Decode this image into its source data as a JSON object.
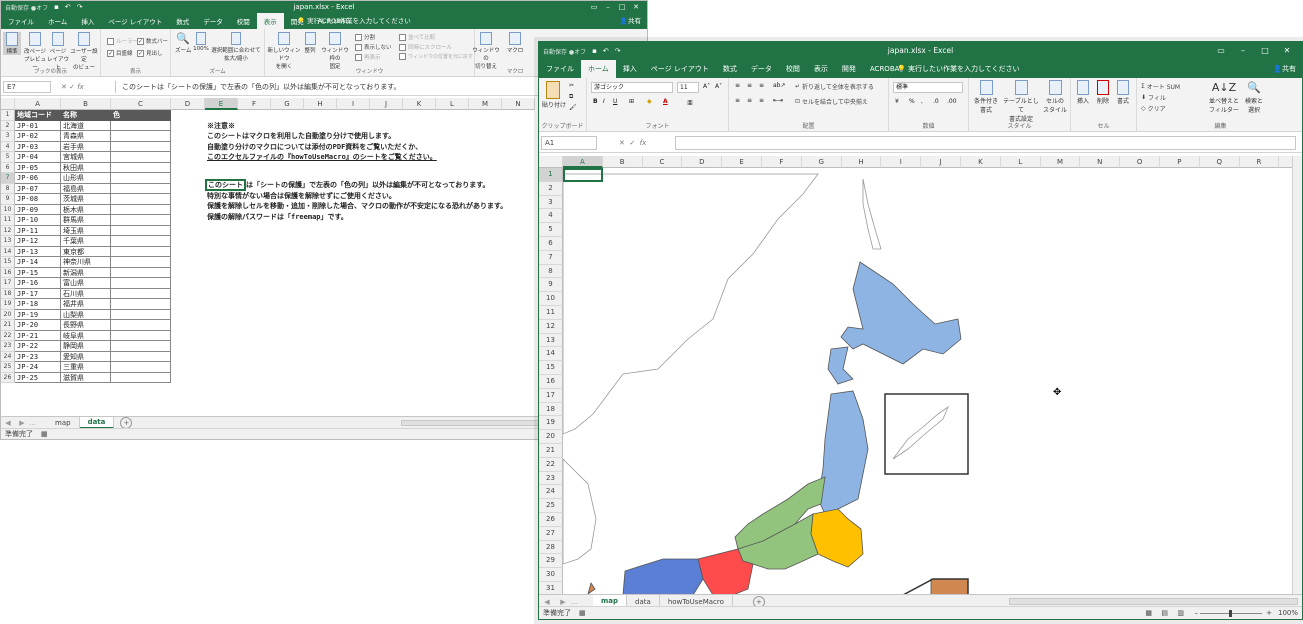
{
  "w1": {
    "title": "japan.xlsx - Excel",
    "autosave": "自動保存 ●オフ",
    "user": "共有",
    "search": "実行したい作業を入力してください",
    "tabs": [
      "ファイル",
      "ホーム",
      "挿入",
      "ページ レイアウト",
      "数式",
      "データ",
      "校閲",
      "表示",
      "開発",
      "ACROBAT"
    ],
    "active_tab": 7,
    "ribbon": {
      "g1_label": "ブックの表示",
      "b_normal": "標準",
      "b_pagebreak": "改ページ\nプレビュー",
      "b_pagelayout": "ページ\nレイアウト",
      "b_custom": "ユーザー設定\nのビュー",
      "g2_label": "表示",
      "cb_ruler": "ルーラー",
      "cb_formula": "数式バー",
      "cb_grid": "目盛線",
      "cb_headings": "見出し",
      "g3_label": "ズーム",
      "b_zoom": "ズーム",
      "b_100": "100%",
      "b_zoomsel": "選択範囲に合わせて\n拡大/縮小",
      "g4_label": "ウィンドウ",
      "b_newwin": "新しいウィンドウ\nを開く",
      "b_arrange": "整列",
      "b_freeze": "ウィンドウ枠の\n固定",
      "s_split": "分割",
      "s_hide": "表示しない",
      "s_unhide": "再表示",
      "s_side": "並べて比較",
      "s_sync": "同時にスクロール",
      "s_reset": "ウィンドウの位置を元に戻す",
      "b_switch": "ウィンドウの\n切り替え",
      "g5_label": "マクロ",
      "b_macro": "マクロ"
    },
    "namebox": "E7",
    "formula": "このシートは「シートの保護」で左表の「色の列」以外は編集が不可となっております。",
    "columns": [
      "A",
      "B",
      "C",
      "D",
      "E",
      "F",
      "G",
      "H",
      "I",
      "J",
      "K",
      "L",
      "M",
      "N"
    ],
    "header_row": [
      "地域コード",
      "名称",
      "色"
    ],
    "rows": [
      [
        "JP-01",
        "北海道"
      ],
      [
        "JP-02",
        "青森県"
      ],
      [
        "JP-03",
        "岩手県"
      ],
      [
        "JP-04",
        "宮城県"
      ],
      [
        "JP-05",
        "秋田県"
      ],
      [
        "JP-06",
        "山形県"
      ],
      [
        "JP-07",
        "福島県"
      ],
      [
        "JP-08",
        "茨城県"
      ],
      [
        "JP-09",
        "栃木県"
      ],
      [
        "JP-10",
        "群馬県"
      ],
      [
        "JP-11",
        "埼玉県"
      ],
      [
        "JP-12",
        "千葉県"
      ],
      [
        "JP-13",
        "東京都"
      ],
      [
        "JP-14",
        "神奈川県"
      ],
      [
        "JP-15",
        "新潟県"
      ],
      [
        "JP-16",
        "富山県"
      ],
      [
        "JP-17",
        "石川県"
      ],
      [
        "JP-18",
        "福井県"
      ],
      [
        "JP-19",
        "山梨県"
      ],
      [
        "JP-20",
        "長野県"
      ],
      [
        "JP-21",
        "岐阜県"
      ],
      [
        "JP-22",
        "静岡県"
      ],
      [
        "JP-23",
        "愛知県"
      ],
      [
        "JP-24",
        "三重県"
      ],
      [
        "JP-25",
        "滋賀県"
      ]
    ],
    "notes": {
      "n1": "※注意※",
      "n2": "このシートはマクロを利用した自動塗り分けで使用します。",
      "n3": "自動塗り分けのマクロについては添付のPDF資料をご覧いただくか、",
      "n4": "このエクセルファイルの『howToUseMacro』のシートをご覧ください。",
      "n5a": "このシート",
      "n5b": "は「シートの保護」で左表の「色の列」以外は編集が不可となっております。",
      "n6": "特別な事情がない場合は保護を解除せずにご使用ください。",
      "n7": "保護を解除しセルを移動・追加・削除した場合、マクロの動作が不安定になる恐れがあります。",
      "n8": "保護の解除パスワードは「freemap」です。"
    },
    "sheets": [
      "map",
      "data"
    ],
    "active_sheet": 1,
    "status": "準備完了"
  },
  "w2": {
    "title": "japan.xlsx - Excel",
    "autosave": "自動保存 ●オフ",
    "user": "共有",
    "search": "実行したい作業を入力してください",
    "tabs": [
      "ファイル",
      "ホーム",
      "挿入",
      "ページ レイアウト",
      "数式",
      "データ",
      "校閲",
      "表示",
      "開発",
      "ACROBAT"
    ],
    "active_tab": 1,
    "ribbon": {
      "paste": "貼り付け",
      "clip": "クリップボード",
      "font_name": "游ゴシック",
      "font_size": "11",
      "font": "フォント",
      "wrap": "折り返して全体を表示する",
      "merge": "セルを結合して中央揃え",
      "align": "配置",
      "numfmt": "標準",
      "number": "数値",
      "cond": "条件付き\n書式",
      "table": "テーブルとして\n書式設定",
      "cellstyle": "セルの\nスタイル",
      "style": "スタイル",
      "insert": "挿入",
      "delete": "削除",
      "format": "書式",
      "cells": "セル",
      "autosum": "オート SUM",
      "fill": "フィル",
      "clear": "クリア",
      "sort": "並べ替えと\nフィルター",
      "find": "検索と\n選択",
      "edit": "編集"
    },
    "namebox": "A1",
    "formula": "",
    "columns": [
      "A",
      "B",
      "C",
      "D",
      "E",
      "F",
      "G",
      "H",
      "I",
      "J",
      "K",
      "L",
      "M",
      "N",
      "O",
      "P",
      "Q",
      "R",
      "S"
    ],
    "rows_count": 31,
    "sheets": [
      "map",
      "data",
      "howToUseMacro"
    ],
    "active_sheet": 0,
    "status": "準備完了",
    "zoom": "100%",
    "colors": {
      "hokkaido_tohoku": "#8db4e2",
      "kanto": "#ffc000",
      "chubu": "#92c47d",
      "kinki": "#ff4b4b",
      "chugoku": "#5b7fd4",
      "okinawa": "#d08850"
    }
  }
}
